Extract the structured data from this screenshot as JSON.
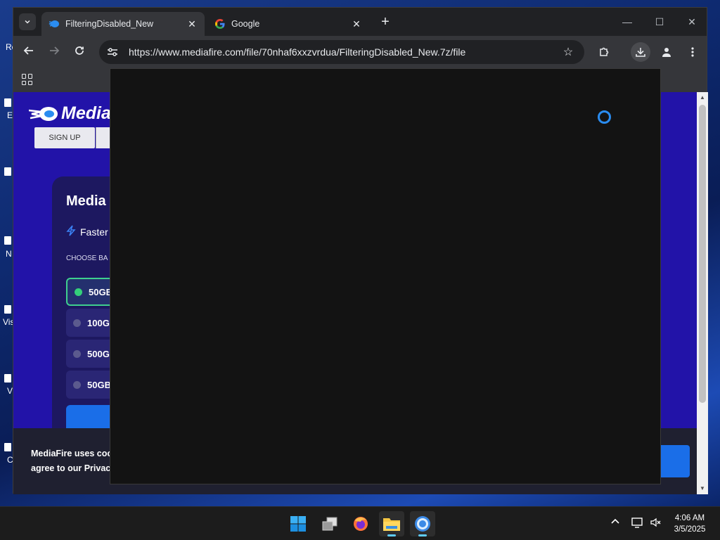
{
  "desktop": {
    "labels": [
      "Re",
      "E",
      "N",
      "Vis",
      "V",
      "C"
    ]
  },
  "browser": {
    "tabs": [
      {
        "title": "FilteringDisabled_New",
        "favicon": "mediafire-icon",
        "active": true
      },
      {
        "title": "Google",
        "favicon": "google-icon",
        "active": false
      }
    ],
    "url": "https://www.mediafire.com/file/70nhaf6xxzvrdua/FilteringDisabled_New.7z/file"
  },
  "page": {
    "logo_text": "Media",
    "signup_label": "SIGN UP",
    "card_title": "Media",
    "feature_text": "Faster",
    "choose_label": "CHOOSE BA",
    "options": [
      {
        "label": "50GB",
        "selected": true
      },
      {
        "label": "100G",
        "selected": false
      },
      {
        "label": "500G",
        "selected": false
      },
      {
        "label": "50GB",
        "selected": false
      }
    ],
    "cookie_line1": "MediaFire uses coo",
    "cookie_line2": "agree to our Privacy",
    "accent_color": "#1a6ee8",
    "background_color": "#2213a8"
  },
  "taskbar": {
    "apps": [
      "start-icon",
      "task-view-icon",
      "firefox-icon",
      "file-explorer-icon",
      "chrome-icon"
    ],
    "time": "4:06 AM",
    "date": "3/5/2025"
  }
}
